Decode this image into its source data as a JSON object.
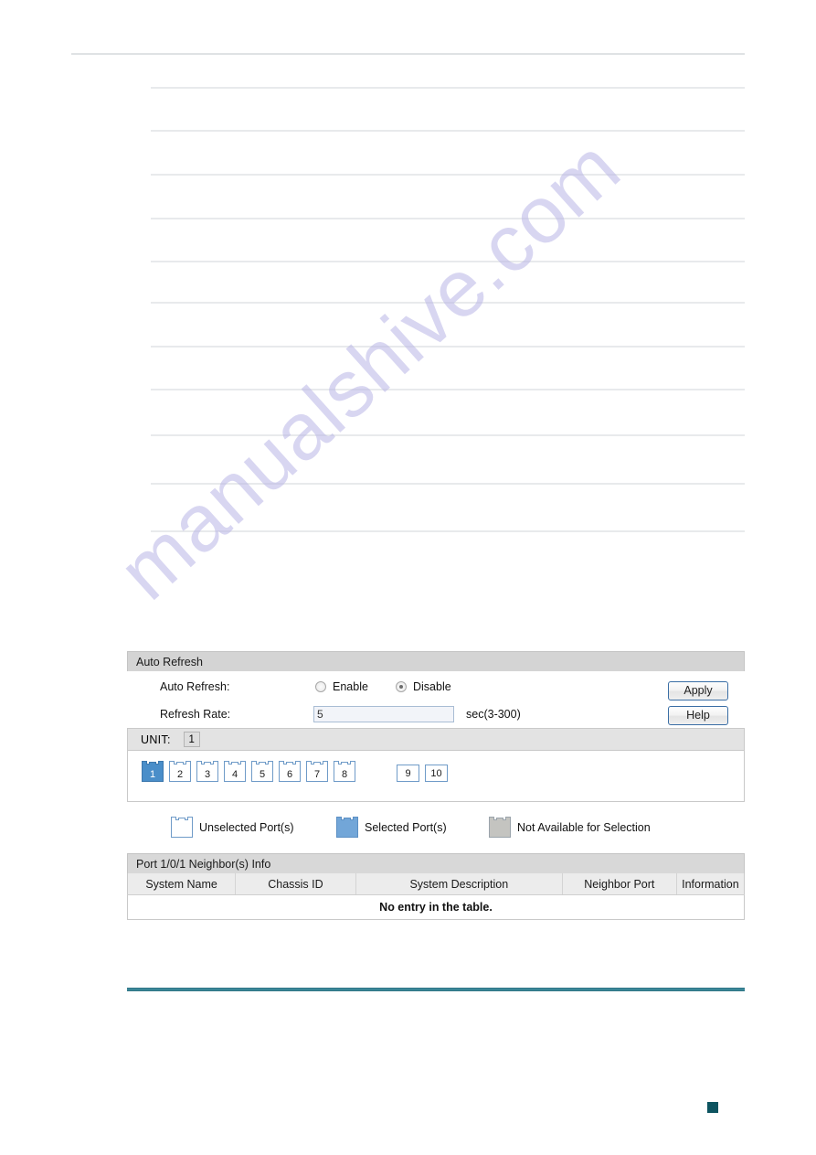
{
  "document": {
    "watermark": "manualshive.com",
    "rule_positions": [
      58,
      95,
      142,
      190,
      238,
      285,
      330,
      378,
      425,
      475,
      528,
      580
    ],
    "accent_teal": "#2d6e7e",
    "marker_color": "#0d5460"
  },
  "auto_refresh": {
    "panel_title": "Auto Refresh",
    "auto_refresh_label": "Auto Refresh:",
    "enable_label": "Enable",
    "disable_label": "Disable",
    "selected_option": "Disable",
    "refresh_rate_label": "Refresh Rate:",
    "refresh_rate_value": "5",
    "refresh_rate_placeholder": "5",
    "refresh_rate_unit": "sec(3-300)",
    "apply_label": "Apply",
    "help_label": "Help"
  },
  "unit": {
    "label": "UNIT:",
    "value": "1"
  },
  "ports": {
    "rj45": [
      {
        "number": "1",
        "state": "selected"
      },
      {
        "number": "2",
        "state": "unselected"
      },
      {
        "number": "3",
        "state": "unselected"
      },
      {
        "number": "4",
        "state": "unselected"
      },
      {
        "number": "5",
        "state": "unselected"
      },
      {
        "number": "6",
        "state": "unselected"
      },
      {
        "number": "7",
        "state": "unselected"
      },
      {
        "number": "8",
        "state": "unselected"
      }
    ],
    "sfp": [
      {
        "number": "9",
        "state": "unselected"
      },
      {
        "number": "10",
        "state": "unselected"
      }
    ]
  },
  "legend": {
    "unselected": "Unselected Port(s)",
    "selected": "Selected Port(s)",
    "unavailable": "Not Available for Selection"
  },
  "neighbor_info": {
    "panel_title": "Port 1/0/1 Neighbor(s) Info",
    "columns": [
      "System Name",
      "Chassis ID",
      "System Description",
      "Neighbor Port",
      "Information"
    ],
    "empty_message": "No entry in the table.",
    "rows": []
  }
}
